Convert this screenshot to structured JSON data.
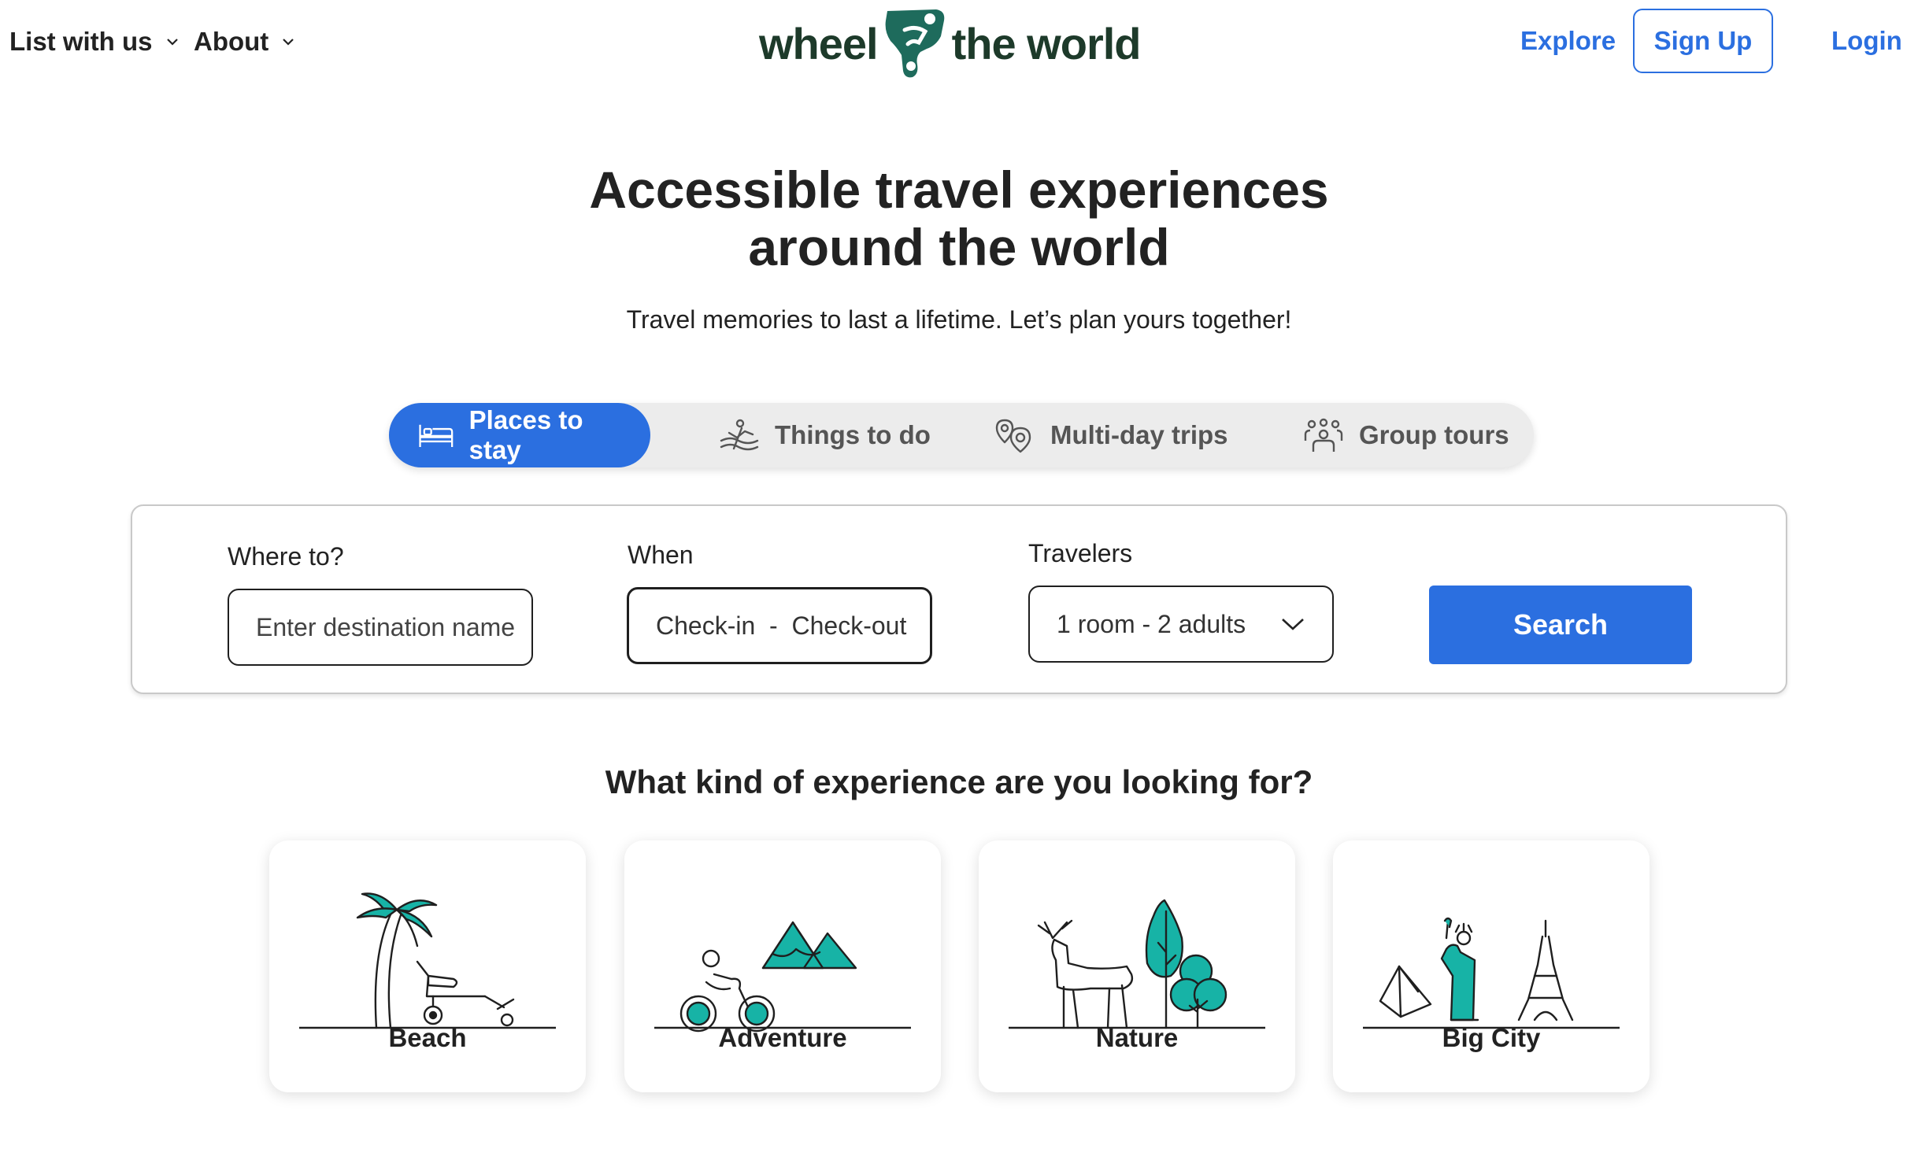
{
  "header": {
    "nav": [
      {
        "label": "List with us",
        "icon": "chevron-down-icon"
      },
      {
        "label": "About",
        "icon": "chevron-down-icon"
      }
    ],
    "logo": {
      "left": "wheel",
      "right": "the world",
      "mark_color": "#1e6b5c"
    },
    "explore_label": "Explore",
    "signup_label": "Sign Up",
    "login_label": "Login"
  },
  "hero": {
    "title_line1": "Accessible travel experiences",
    "title_line2": "around the world",
    "subtitle": "Travel memories to last a lifetime. Let’s plan yours together!"
  },
  "tabs": [
    {
      "label": "Places to stay",
      "icon": "bed-icon",
      "active": true
    },
    {
      "label": "Things to do",
      "icon": "activity-icon",
      "active": false
    },
    {
      "label": "Multi-day trips",
      "icon": "map-pins-icon",
      "active": false
    },
    {
      "label": "Group tours",
      "icon": "group-icon",
      "active": false
    }
  ],
  "search": {
    "where_label": "Where to?",
    "where_placeholder": "Enter destination name",
    "when_label": "When",
    "when_value": "Check-in  -  Check-out",
    "travelers_label": "Travelers",
    "travelers_value": "1 room - 2 adults",
    "search_label": "Search"
  },
  "experiences": {
    "title": "What kind of experience are you looking for?",
    "cards": [
      {
        "label": "Beach",
        "icon": "palm-tree-icon"
      },
      {
        "label": "Adventure",
        "icon": "mountains-icon"
      },
      {
        "label": "Nature",
        "icon": "deer-trees-icon"
      },
      {
        "label": "Big City",
        "icon": "landmarks-icon"
      }
    ]
  },
  "colors": {
    "accent": "#2b6fe0",
    "teal": "#17b3a6",
    "logo_text": "#1d3a2a"
  }
}
